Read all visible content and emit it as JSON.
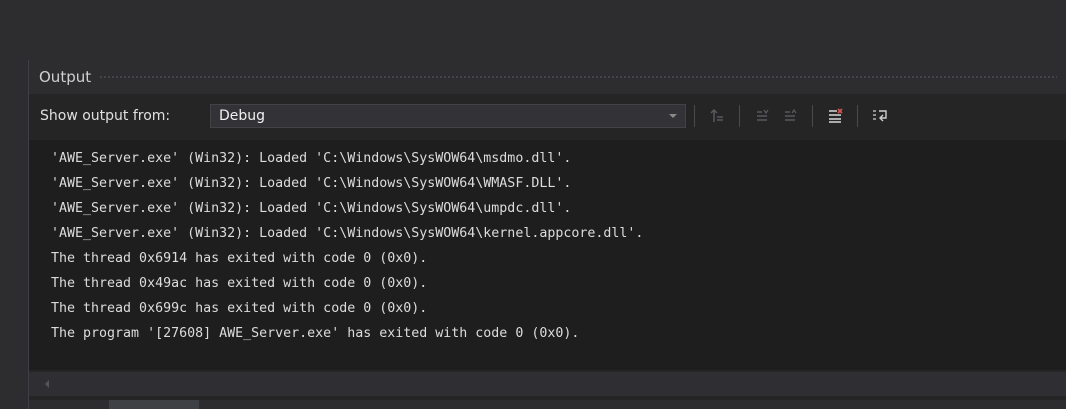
{
  "panel": {
    "title": "Output"
  },
  "toolbar": {
    "show_output_label": "Show output from:",
    "source_value": "Debug",
    "buttons": [
      {
        "icon": "go-to-previous-message-icon"
      },
      {
        "icon": "find-message-icon"
      },
      {
        "icon": "go-to-next-message-icon"
      },
      {
        "icon": "clear-all-icon"
      },
      {
        "icon": "toggle-word-wrap-icon"
      }
    ]
  },
  "output": {
    "lines": [
      "'AWE_Server.exe' (Win32): Loaded 'C:\\Windows\\SysWOW64\\msdmo.dll'.",
      "'AWE_Server.exe' (Win32): Loaded 'C:\\Windows\\SysWOW64\\WMASF.DLL'.",
      "'AWE_Server.exe' (Win32): Loaded 'C:\\Windows\\SysWOW64\\umpdc.dll'.",
      "'AWE_Server.exe' (Win32): Loaded 'C:\\Windows\\SysWOW64\\kernel.appcore.dll'.",
      "The thread 0x6914 has exited with code 0 (0x0).",
      "The thread 0x49ac has exited with code 0 (0x0).",
      "The thread 0x699c has exited with code 0 (0x0).",
      "The program '[27608] AWE_Server.exe' has exited with code 0 (0x0)."
    ]
  },
  "colors": {
    "background": "#1e1e1e",
    "panel": "#252526",
    "text": "#dcdcdc",
    "clear_icon_accent": "#e05252"
  }
}
